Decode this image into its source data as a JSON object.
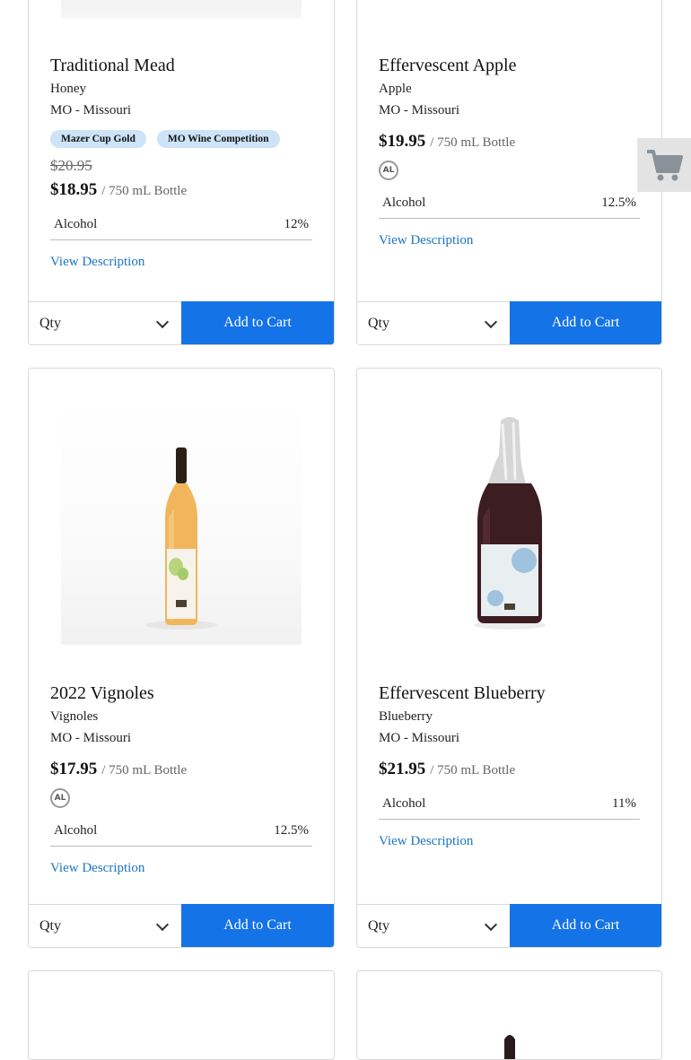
{
  "products": [
    {
      "name": "Traditional Mead",
      "varietal": "Honey",
      "region": "MO - Missouri",
      "badges": [
        "Mazer Cup Gold",
        "MO Wine Competition"
      ],
      "old_price": "$20.95",
      "price": "$18.95",
      "unit": "/ 750 mL Bottle",
      "alcohol_label": "Alcohol",
      "alcohol_value": "12%",
      "view_description": "View Description",
      "qty_label": "Qty",
      "add_to_cart": "Add to Cart"
    },
    {
      "name": "Effervescent Apple",
      "varietal": "Apple",
      "region": "MO - Missouri",
      "price": "$19.95",
      "unit": "/ 750 mL Bottle",
      "al_badge": "AL",
      "alcohol_label": "Alcohol",
      "alcohol_value": "12.5%",
      "view_description": "View Description",
      "qty_label": "Qty",
      "add_to_cart": "Add to Cart"
    },
    {
      "name": "2022 Vignoles",
      "varietal": "Vignoles",
      "region": "MO - Missouri",
      "price": "$17.95",
      "unit": "/ 750 mL Bottle",
      "al_badge": "AL",
      "alcohol_label": "Alcohol",
      "alcohol_value": "12.5%",
      "view_description": "View Description",
      "qty_label": "Qty",
      "add_to_cart": "Add to Cart"
    },
    {
      "name": "Effervescent Blueberry",
      "varietal": "Blueberry",
      "region": "MO - Missouri",
      "price": "$21.95",
      "unit": "/ 750 mL Bottle",
      "alcohol_label": "Alcohol",
      "alcohol_value": "11%",
      "view_description": "View Description",
      "qty_label": "Qty",
      "add_to_cart": "Add to Cart"
    }
  ],
  "colors": {
    "accent": "#1473e6",
    "link": "#1b74c5",
    "badge_bg": "#cde3f7"
  },
  "icons": {
    "floating_cart": "shopping-cart-icon"
  }
}
